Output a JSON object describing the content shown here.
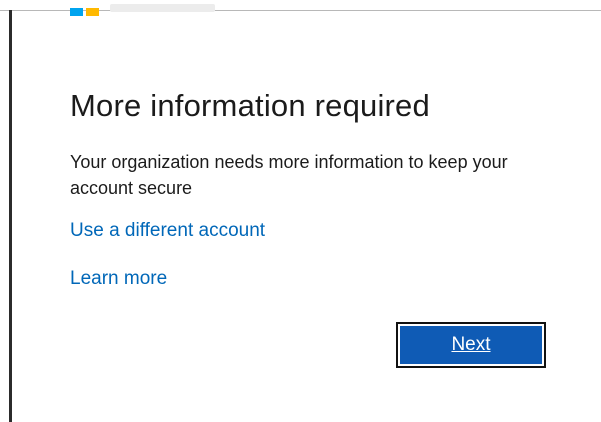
{
  "colors": {
    "text": "#1b1b1b",
    "link": "#0067b8",
    "button_bg": "#0f5bb5",
    "button_text": "#ffffff",
    "logo_blue": "#00a4ef",
    "logo_yellow": "#ffb900"
  },
  "header": {
    "logo_icon": "microsoft-logo"
  },
  "main": {
    "title": "More information required",
    "description": "Your organization needs more information to keep your account secure",
    "links": {
      "different_account": "Use a different account",
      "learn_more": "Learn more"
    },
    "next_button_label": "Next"
  }
}
